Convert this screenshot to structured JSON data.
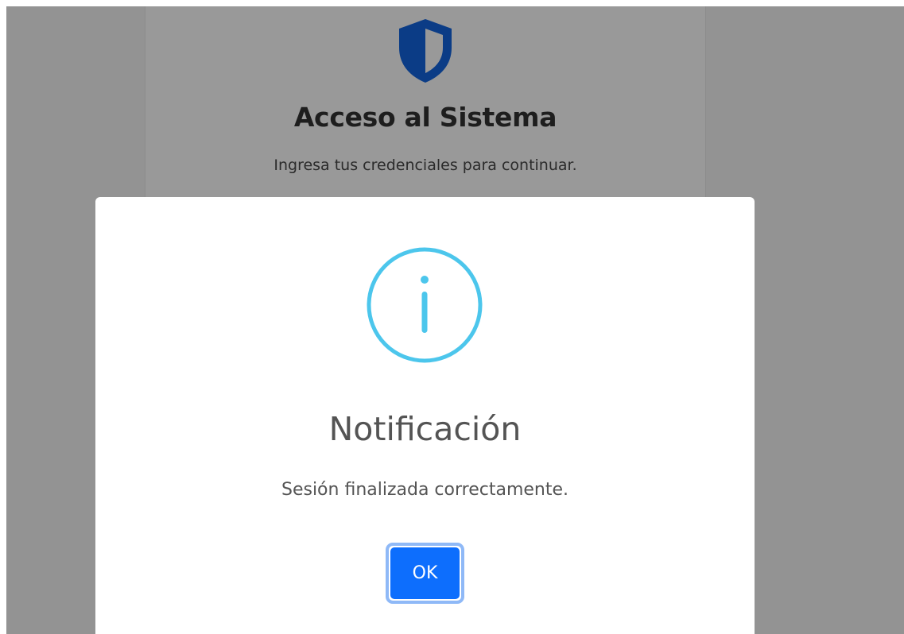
{
  "login": {
    "title": "Acceso al Sistema",
    "subtitle": "Ingresa tus credenciales para continuar."
  },
  "dialog": {
    "title": "Notificación",
    "message": "Sesión finalizada correctamente.",
    "ok_label": "OK"
  },
  "icons": {
    "login_icon": "shield-icon",
    "dialog_icon": "info-icon"
  },
  "colors": {
    "shield": "#0d47a1",
    "info": "#3fc3ee",
    "ok_button": "#0d6efd",
    "backdrop": "#939393"
  }
}
